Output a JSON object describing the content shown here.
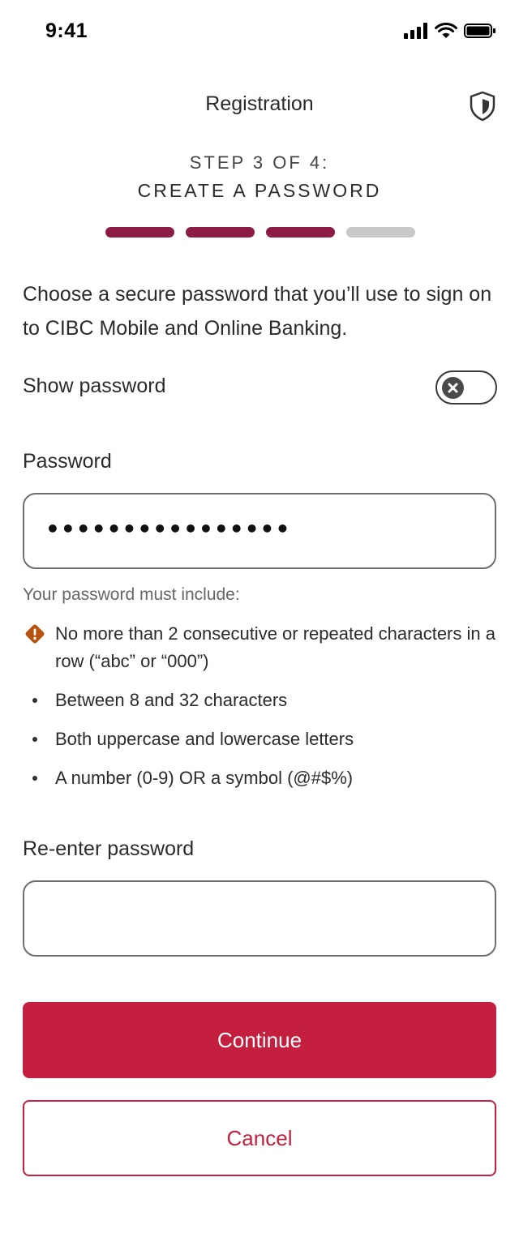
{
  "status_bar": {
    "time": "9:41"
  },
  "header": {
    "title": "Registration",
    "shield_icon": "shield-icon"
  },
  "step": {
    "label": "STEP 3 OF 4:",
    "title": "CREATE A PASSWORD",
    "total_steps": 4,
    "current_step": 3,
    "active_color": "#8c1b45",
    "inactive_color": "#c8c8c8"
  },
  "intro_text": "Choose a secure password that you’ll use to sign on to CIBC Mobile and Online Banking.",
  "show_password": {
    "label": "Show password",
    "enabled": false
  },
  "password": {
    "label": "Password",
    "value": "••••••••••••••••"
  },
  "requirements": {
    "heading": "Your password must include:",
    "items": [
      {
        "text": "No more than 2 consecutive or repeated characters in a row (“abc” or “000”)",
        "icon": "warning-icon",
        "status": "warning"
      },
      {
        "text": "Between 8 and 32 characters",
        "icon": "bullet",
        "status": "neutral"
      },
      {
        "text": "Both uppercase and lowercase letters",
        "icon": "bullet",
        "status": "neutral"
      },
      {
        "text": "A number (0-9) OR a symbol (@#$%)",
        "icon": "bullet",
        "status": "neutral"
      }
    ],
    "warning_color": "#b5530f"
  },
  "reenter": {
    "label": "Re-enter password",
    "value": ""
  },
  "buttons": {
    "continue_label": "Continue",
    "cancel_label": "Cancel",
    "brand_color": "#c41f3e"
  }
}
